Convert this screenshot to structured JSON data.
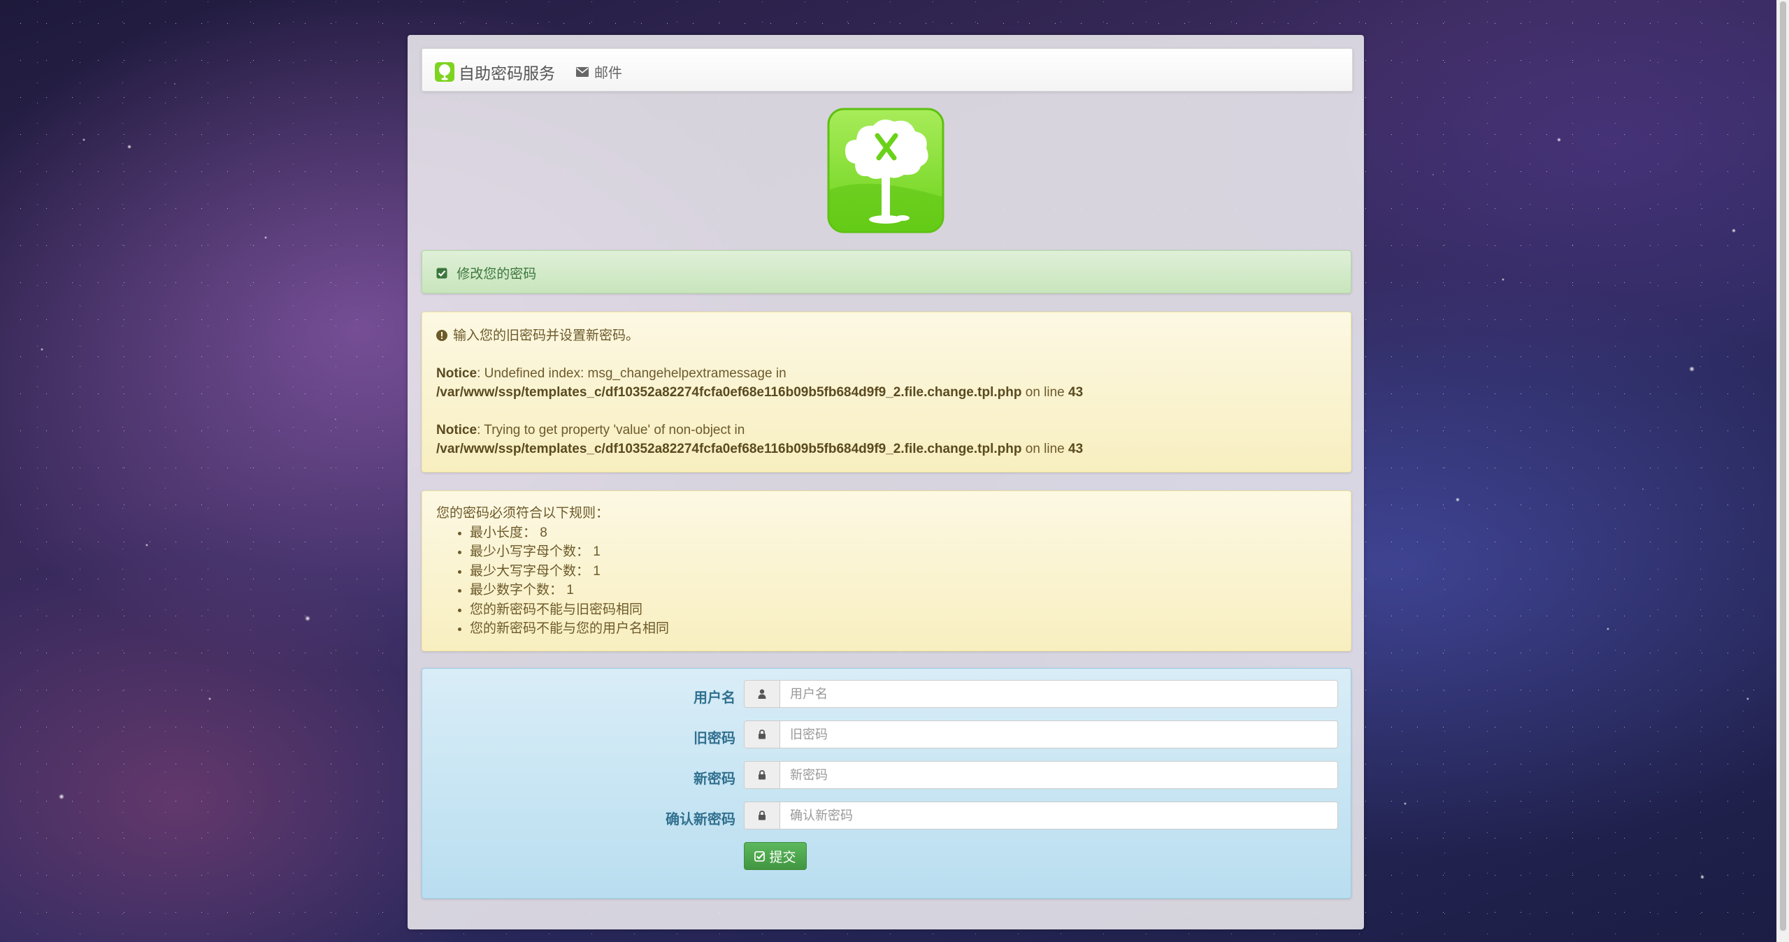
{
  "navbar": {
    "brand_label": "自助密码服务",
    "brand_icon": "tree-logo-icon",
    "mail_label": "邮件",
    "mail_icon": "envelope-icon"
  },
  "logo": {
    "icon": "tree-logo-icon",
    "color": "#7ed321"
  },
  "success_alert": {
    "icon": "check-square-icon",
    "text": "修改您的密码"
  },
  "warning_alert": {
    "icon": "exclamation-circle-icon",
    "intro": "输入您的旧密码并设置新密码。",
    "notices": [
      {
        "label": "Notice",
        "message": ": Undefined index: msg_changehelpextramessage in",
        "path": "/var/www/ssp/templates_c/df10352a82274fcfa0ef68e116b09b5fb684d9f9_2.file.change.tpl.php",
        "on_line": " on line ",
        "line": "43"
      },
      {
        "label": "Notice",
        "message": ": Trying to get property 'value' of non-object in",
        "path": "/var/www/ssp/templates_c/df10352a82274fcfa0ef68e116b09b5fb684d9f9_2.file.change.tpl.php",
        "on_line": " on line ",
        "line": "43"
      }
    ]
  },
  "rules": {
    "heading": "您的密码必须符合以下规则：",
    "items": [
      "最小长度： 8",
      "最少小写字母个数： 1",
      "最少大写字母个数： 1",
      "最少数字个数： 1",
      "您的新密码不能与旧密码相同",
      "您的新密码不能与您的用户名相同"
    ]
  },
  "form": {
    "username": {
      "label": "用户名",
      "placeholder": "用户名",
      "icon": "user-icon"
    },
    "old_password": {
      "label": "旧密码",
      "placeholder": "旧密码",
      "icon": "lock-icon"
    },
    "new_password": {
      "label": "新密码",
      "placeholder": "新密码",
      "icon": "lock-icon"
    },
    "confirm_password": {
      "label": "确认新密码",
      "placeholder": "确认新密码",
      "icon": "lock-icon"
    },
    "submit_label": "提交",
    "submit_icon": "check-square-icon"
  },
  "colors": {
    "success_green": "#5cb85c",
    "info_blue": "#31708f",
    "warning_text": "#6d5a2a"
  }
}
